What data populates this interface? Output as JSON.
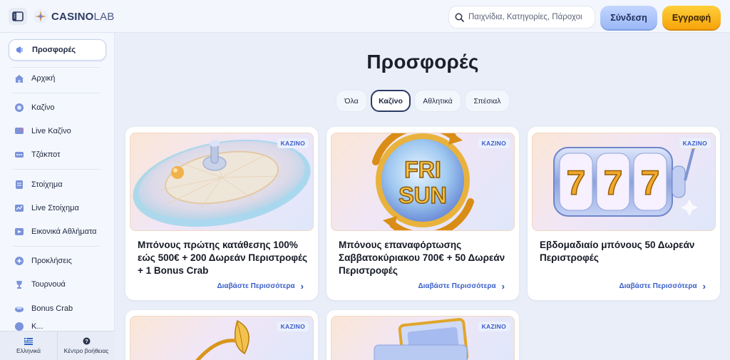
{
  "header": {
    "logo_bold": "CASINO",
    "logo_light": "LAB",
    "search_placeholder": "Παιχνίδια, Κατηγορίες, Πάροχοι",
    "login_label": "Σύνδεση",
    "register_label": "Εγγραφή"
  },
  "sidebar": {
    "items": [
      {
        "label": "Προσφορές",
        "icon": "megaphone-icon"
      },
      {
        "label": "Αρχική",
        "icon": "home-icon"
      },
      {
        "label": "Καζίνο",
        "icon": "casino-chip-icon"
      },
      {
        "label": "Live Καζίνο",
        "icon": "live-casino-icon"
      },
      {
        "label": "Τζάκποτ",
        "icon": "jackpot-icon"
      },
      {
        "label": "Στοίχημα",
        "icon": "betslip-icon"
      },
      {
        "label": "Live Στοίχημα",
        "icon": "live-betting-icon"
      },
      {
        "label": "Εικονικά Αθλήματα",
        "icon": "virtual-sports-icon"
      },
      {
        "label": "Προκλήσεις",
        "icon": "challenges-icon"
      },
      {
        "label": "Τουρνουά",
        "icon": "trophy-icon"
      },
      {
        "label": "Bonus Crab",
        "icon": "bonus-crab-icon"
      },
      {
        "label": "Κ...",
        "icon": "partial-icon"
      }
    ],
    "footer": {
      "language_label": "Ελληνικά",
      "help_label": "Κέντρο βοήθειας"
    }
  },
  "main": {
    "title": "Προσφορές",
    "tabs": [
      {
        "label": "Όλα"
      },
      {
        "label": "Καζίνο"
      },
      {
        "label": "Αθλητικά"
      },
      {
        "label": "Σπέσιαλ"
      }
    ],
    "active_tab": "Καζίνο",
    "cards": [
      {
        "badge": "ΚΑΖΙΝΟ",
        "title": "Μπόνους πρώτης κατάθεσης 100% εώς 500€ + 200 Δωρεάν Περιστροφές + 1 Bonus Crab",
        "link": "Διαβάστε Περισσότερα",
        "art": "roulette-wheel"
      },
      {
        "badge": "ΚΑΖΙΝΟ",
        "title": "Μπόνους επαναφόρτωσης Σαββατοκύριακου 700€ + 50 Δωρεάν Περιστροφές",
        "link": "Διαβάστε Περισσότερα",
        "art": "fri-sun",
        "art_text_1": "FRI",
        "art_text_2": "SUN"
      },
      {
        "badge": "ΚΑΖΙΝΟ",
        "title": "Εβδομαδιαίο μπόνους 50 Δωρεάν Περιστροφές",
        "link": "Διαβάστε Περισσότερα",
        "art": "slot-777",
        "art_text": "777"
      },
      {
        "badge": "ΚΑΖΙΝΟ",
        "title": "",
        "link": "",
        "art": "golden-leaf"
      },
      {
        "badge": "ΚΑΖΙΝΟ",
        "title": "",
        "link": "",
        "art": "cash-stack"
      }
    ]
  },
  "colors": {
    "accent_blue": "#3a5fc9",
    "login_bg": "#9ab7f6",
    "register_bg": "#f7a40a",
    "page_bg": "#e9eef8"
  }
}
